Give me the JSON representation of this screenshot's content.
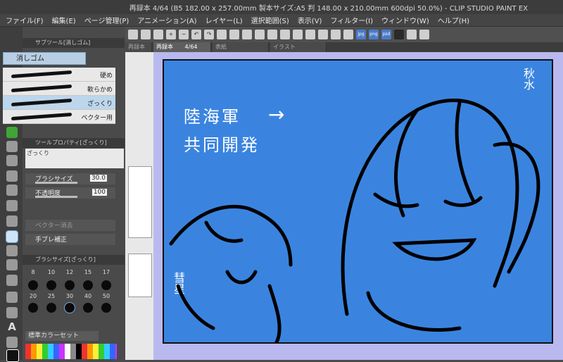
{
  "window": {
    "title": "再録本 4/64 (B5 182.00 x 257.00mm 製本サイズ:A5 判 148.00 x 210.00mm 600dpi 50.0%) - CLIP STUDIO PAINT EX"
  },
  "menu": {
    "items": [
      "ファイル(F)",
      "編集(E)",
      "ページ管理(P)",
      "アニメーション(A)",
      "レイヤー(L)",
      "選択範囲(S)",
      "表示(V)",
      "フィルター(I)",
      "ウィンドウ(W)",
      "ヘルプ(H)"
    ]
  },
  "subtool": {
    "header": "サブツール[消しゴム]",
    "active_label": "消しゴム",
    "brushes": [
      {
        "label": "硬め"
      },
      {
        "label": "軟らかめ"
      },
      {
        "label": "ざっくり",
        "selected": true
      },
      {
        "label": "ベクター用"
      }
    ]
  },
  "tool_property": {
    "header": "ツールプロパティ[ざっくり]",
    "preview_label": "ざっくり",
    "brush_size_label": "ブラシサイズ",
    "brush_size_value": "30.0",
    "opacity_label": "不透明度",
    "opacity_value": "100",
    "vector_erase_label": "ベクター消去",
    "stabilize_label": "手ブレ補正"
  },
  "brush_size_palette": {
    "header": "ブラシサイズ[ざっくり]",
    "row1": [
      "8",
      "10",
      "12",
      "15",
      "17"
    ],
    "row2": [
      "20",
      "25",
      "30",
      "40",
      "50"
    ]
  },
  "color_set": {
    "label": "標準カラーセット"
  },
  "tabs": [
    {
      "label": "再録本",
      "active": false
    },
    {
      "label": "再録本",
      "page": "4/64",
      "active": true
    },
    {
      "label": "表紙",
      "active": false
    },
    {
      "label": "イラスト",
      "active": false
    }
  ],
  "canvas": {
    "background": "#3a84e0",
    "text_line1": "陸海軍",
    "text_line2": "共同開発",
    "arrow": "→",
    "name_right": "秋水",
    "name_left": "彗星"
  },
  "colors": {
    "accent": "#4a7cc9",
    "canvas_bg": "#b9b9ef",
    "panel": "#4a4a4a"
  }
}
